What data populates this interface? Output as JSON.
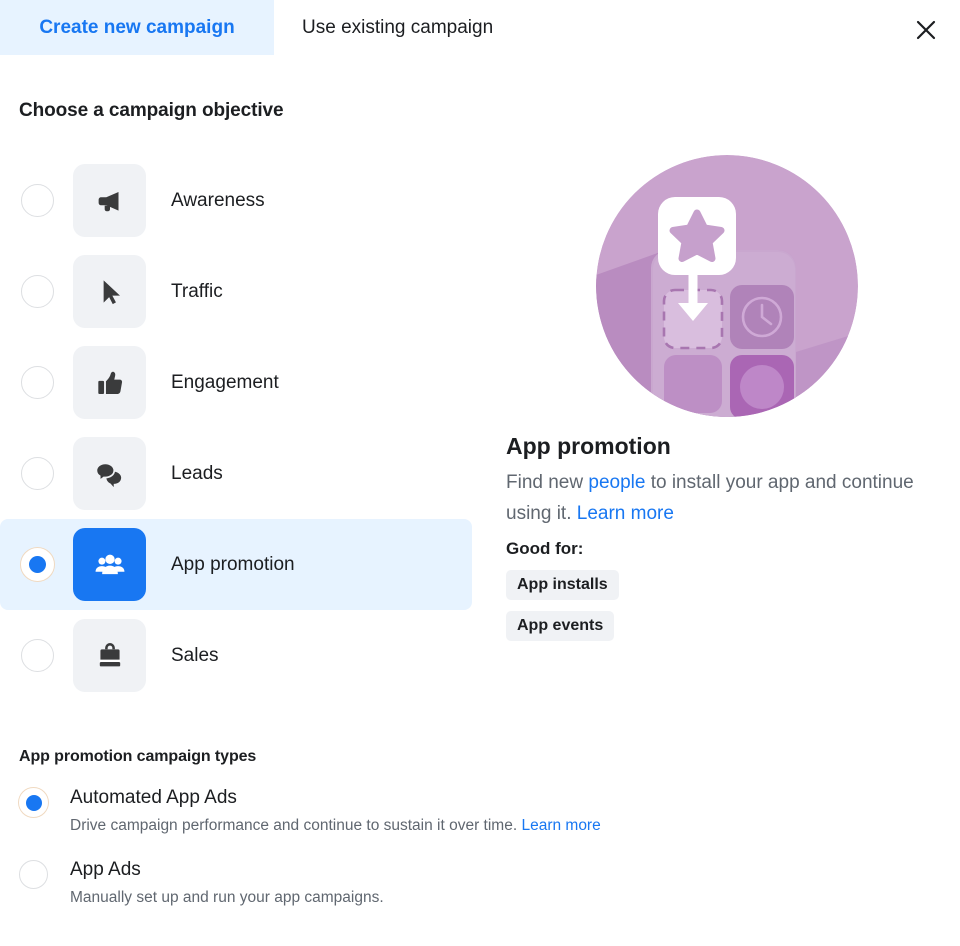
{
  "header": {
    "tabs": [
      {
        "label": "Create new campaign",
        "active": true
      },
      {
        "label": "Use existing campaign",
        "active": false
      }
    ],
    "close_icon": "close-icon"
  },
  "objective_section": {
    "title": "Choose a campaign objective",
    "options": [
      {
        "label": "Awareness",
        "icon": "megaphone-icon",
        "selected": false
      },
      {
        "label": "Traffic",
        "icon": "cursor-icon",
        "selected": false
      },
      {
        "label": "Engagement",
        "icon": "thumbs-up-icon",
        "selected": false
      },
      {
        "label": "Leads",
        "icon": "chat-bubble-icon",
        "selected": false
      },
      {
        "label": "App promotion",
        "icon": "people-group-icon",
        "selected": true
      },
      {
        "label": "Sales",
        "icon": "briefcase-icon",
        "selected": false
      }
    ]
  },
  "detail": {
    "illustration": "app-install-illustration",
    "title": "App promotion",
    "description_part1": "Find new ",
    "description_link1": "people",
    "description_part2": " to install your app and continue using it. ",
    "description_link2": "Learn more",
    "good_for_label": "Good for:",
    "badges": [
      "App installs",
      "App events"
    ]
  },
  "campaign_types": {
    "title": "App promotion campaign types",
    "options": [
      {
        "name": "Automated App Ads",
        "description": "Drive campaign performance and continue to sustain it over time. ",
        "link": "Learn more",
        "selected": true
      },
      {
        "name": "App Ads",
        "description": "Manually set up and run your app campaigns.",
        "link": "",
        "selected": false
      }
    ]
  },
  "colors": {
    "accent": "#1877f2",
    "accent_bg": "#e7f3ff",
    "tile_bg": "#f0f2f5",
    "text": "#1c1e21",
    "muted": "#606770"
  }
}
